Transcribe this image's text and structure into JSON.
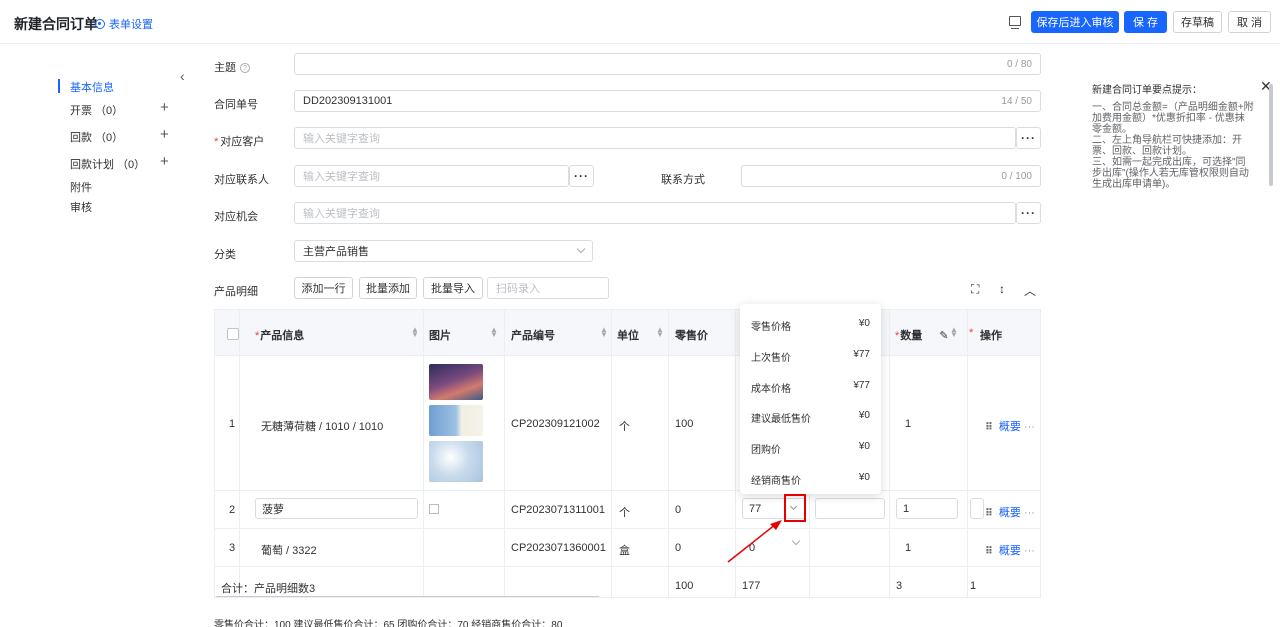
{
  "header": {
    "title": "新建合同订单",
    "form_settings": "表单设置",
    "buttons": {
      "save_submit": "保存后进入审核",
      "save": "保 存",
      "draft": "存草稿",
      "cancel": "取 消"
    },
    "colors": {
      "primary": "#1966ff"
    }
  },
  "sidebar": {
    "items": [
      {
        "label": "基本信息",
        "active": true
      },
      {
        "label": "开票 （0）",
        "has_add": true
      },
      {
        "label": "回款 （0）",
        "has_add": true
      },
      {
        "label": "回款计划 （0）",
        "has_add": true
      },
      {
        "label": "附件"
      },
      {
        "label": "审核"
      }
    ]
  },
  "form": {
    "subject": {
      "label": "主题",
      "value": "",
      "counter": "0 / 80"
    },
    "contract_no": {
      "label": "合同单号",
      "value": "DD202309131001",
      "counter": "14 / 50"
    },
    "customer": {
      "label": "对应客户",
      "placeholder": "输入关键字查询"
    },
    "contact": {
      "label": "对应联系人",
      "placeholder": "输入关键字查询"
    },
    "contact_method": {
      "label": "联系方式",
      "counter": "0 / 100"
    },
    "opportunity": {
      "label": "对应机会",
      "placeholder": "输入关键字查询"
    },
    "category": {
      "label": "分类",
      "value": "主营产品销售"
    },
    "product_detail": {
      "label": "产品明细",
      "add_row": "添加一行",
      "batch_add": "批量添加",
      "batch_import": "批量导入",
      "scan_placeholder": "扫码录入"
    }
  },
  "table": {
    "headers": {
      "product_info": "产品信息",
      "image": "图片",
      "product_code": "产品编号",
      "unit": "单位",
      "retail_price": "零售价",
      "quantity": "数量",
      "actions": "操作"
    },
    "rows": [
      {
        "index": "1",
        "product": "无糖薄荷糖 / 1010 / 1010",
        "code": "CP202309121002",
        "unit": "个",
        "retail": "100",
        "qty": "1",
        "op": "概要"
      },
      {
        "index": "2",
        "product": "菠萝",
        "code": "CP2023071311001",
        "unit": "个",
        "retail": "0",
        "price": "77",
        "qty": "1",
        "op": "概要"
      },
      {
        "index": "3",
        "product": "葡萄 / 3322",
        "code": "CP2023071360001",
        "unit": "盒",
        "retail": "0",
        "price": "0",
        "qty": "1",
        "op": "概要"
      }
    ],
    "footer": {
      "label": "合计：产品明细数3",
      "retail_total": "100",
      "price_total": "177",
      "qty_total": "3",
      "last": "1"
    }
  },
  "summary": "零售价合计：100  建议最低售价合计：65  团购价合计：70  经销商售价合计：80",
  "price_popup": [
    {
      "label": "零售价格",
      "value": "¥0"
    },
    {
      "label": "上次售价",
      "value": "¥77"
    },
    {
      "label": "成本价格",
      "value": "¥77"
    },
    {
      "label": "建议最低售价",
      "value": "¥0"
    },
    {
      "label": "团购价",
      "value": "¥0"
    },
    {
      "label": "经销商售价",
      "value": "¥0"
    }
  ],
  "tips": {
    "title": "新建合同订单要点提示：",
    "lines": [
      "一、合同总金额=（产品明细金额+附加费用金额）*优惠折扣率 - 优惠抹零金额。",
      "二、左上角导航栏可快捷添加：开票、回款、回款计划。",
      "三、如需一起完成出库，可选择\"同步出库\"(操作人若无库管权限则自动生成出库申请单)。"
    ]
  }
}
